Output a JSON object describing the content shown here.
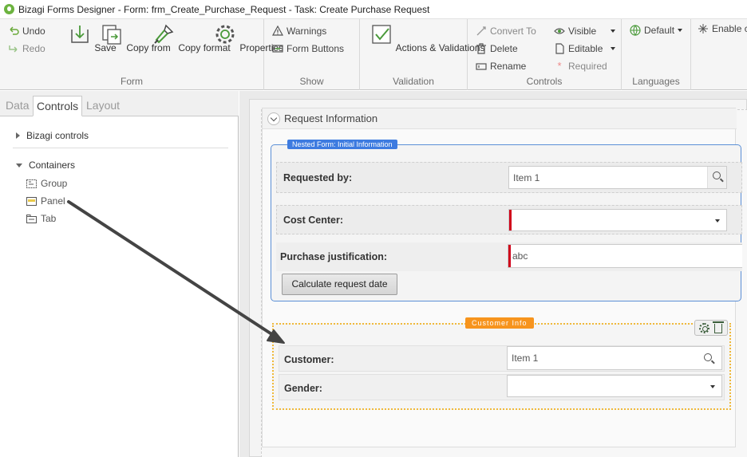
{
  "window": {
    "title": "Bizagi Forms Designer  -  Form: frm_Create_Purchase_Request - Task:  Create Purchase Request"
  },
  "ribbon": {
    "form": {
      "label": "Form",
      "undo": "Undo",
      "redo": "Redo",
      "save": "Save",
      "copy_from": "Copy from",
      "copy_format": "Copy format",
      "properties": "Properties"
    },
    "show": {
      "label": "Show",
      "warnings": "Warnings",
      "form_buttons": "Form Buttons"
    },
    "validation": {
      "label": "Validation",
      "actions_validations": "Actions & Validations"
    },
    "controls": {
      "label": "Controls",
      "convert_to": "Convert To",
      "delete": "Delete",
      "rename": "Rename",
      "visible": "Visible",
      "editable": "Editable",
      "required": "Required"
    },
    "languages": {
      "label": "Languages",
      "default": "Default"
    },
    "enable": "Enable c"
  },
  "left_panel": {
    "tabs": [
      "Data",
      "Controls",
      "Layout"
    ],
    "active_tab": "Controls",
    "tree": {
      "bizagi_controls": "Bizagi controls",
      "containers": "Containers",
      "items": [
        "Group",
        "Panel",
        "Tab"
      ]
    }
  },
  "form": {
    "request_info": {
      "title": "Request Information",
      "nested_badge": "Nested Form: Initial Information",
      "fields": {
        "requested_by": {
          "label": "Requested by:",
          "value": "Item 1"
        },
        "cost_center": {
          "label": "Cost Center:",
          "value": ""
        },
        "purchase_justification": {
          "label": "Purchase justification:",
          "value": "abc"
        }
      },
      "calc_button": "Calculate request date"
    },
    "customer_info": {
      "badge": "Customer Info",
      "fields": {
        "customer": {
          "label": "Customer:",
          "value": "Item 1"
        },
        "gender": {
          "label": "Gender:",
          "value": ""
        }
      }
    }
  },
  "colors": {
    "accent_blue": "#3d7be0",
    "badge_orange": "#f7941d",
    "required_red": "#d0021b",
    "icon_green": "#3b5e3b",
    "arrow": "#444444"
  }
}
